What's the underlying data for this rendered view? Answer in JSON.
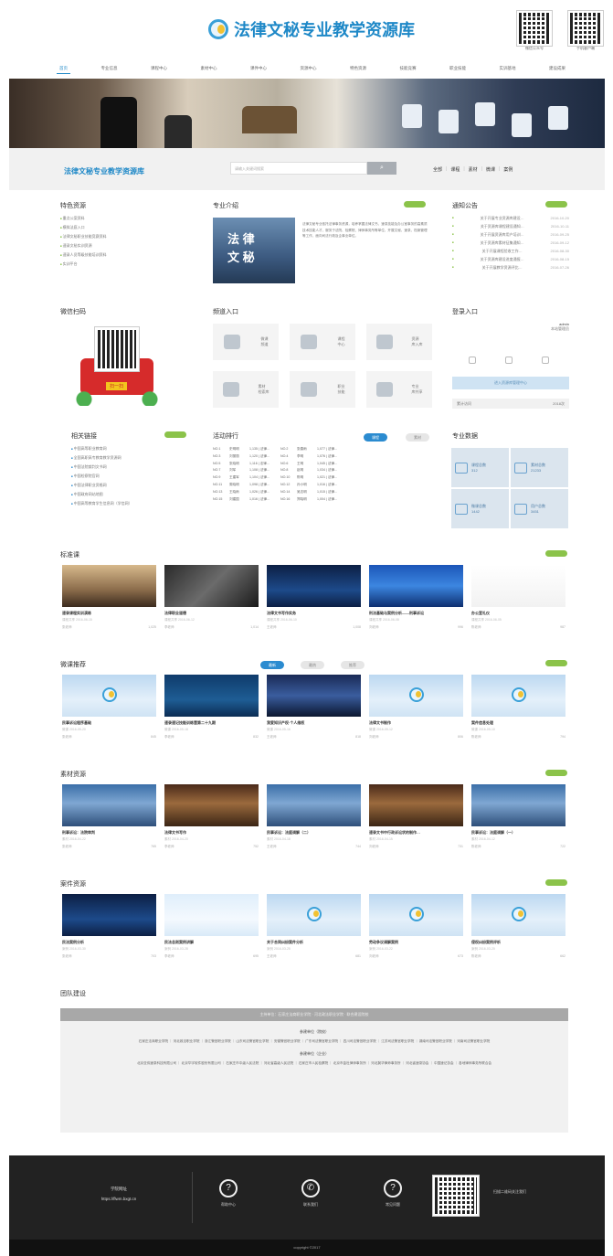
{
  "header": {
    "site_title": "法律文秘专业教学资源库",
    "qr": [
      {
        "caption": "微信公众号"
      },
      {
        "caption": "手机客户端"
      }
    ]
  },
  "nav": {
    "items": [
      "首页",
      "专业信息",
      "课程中心",
      "素材中心",
      "课件中心",
      "资源中心",
      "特色资源",
      "技能竞赛",
      "职业技能",
      "实训基地",
      "建设成果"
    ],
    "active": 0
  },
  "search": {
    "band_title": "法律文秘专业教学资源库",
    "placeholder": "请输入关键词搜索",
    "button": "搜索",
    "links": [
      "全部",
      "课程",
      "素材",
      "微课",
      "案例"
    ]
  },
  "feature": {
    "title": "特色资源",
    "items": [
      "重点公案资料",
      "模拟法庭入口",
      "法律文秘职业技能竞赛资料",
      "速录文秘实训资源",
      "速录人员等级技能培训资料",
      "实训平台"
    ]
  },
  "intro": {
    "title": "专业介绍",
    "image_text": [
      "法 律",
      "文 秘"
    ],
    "text": "法律文秘专业依托法律事务资源，培养掌握法律文书、速录技能及办公室事务的高素质技术技能人才，服务于法院、检察院、律师事务所等单位，开展文秘、速录、档案管理等工作，面向司法行政及企事业单位。"
  },
  "notice": {
    "title": "通知公告",
    "items": [
      {
        "t": "关于开展专业资源库建设…",
        "d": "2016-10-20"
      },
      {
        "t": "关于资源库课程建设通知…",
        "d": "2016-10-11"
      },
      {
        "t": "关于开展资源库用户培训…",
        "d": "2016-09-25"
      },
      {
        "t": "关于资源库素材征集通知…",
        "d": "2016-09-12"
      },
      {
        "t": "关于开展课程验收工作…",
        "d": "2016-08-30"
      },
      {
        "t": "关于资源库建设进度通报…",
        "d": "2016-08-15"
      },
      {
        "t": "关于开展教学资源评比…",
        "d": "2016-07-26"
      }
    ]
  },
  "wechat": {
    "title": "微信扫码",
    "badge": "扫一扫"
  },
  "entry": {
    "title": "频道入口",
    "tiles": [
      [
        "微课",
        "频道"
      ],
      [
        "课程",
        "中心"
      ],
      [
        "资源",
        "库入库"
      ],
      [
        "素材",
        "检索库"
      ],
      [
        "职业",
        "技能"
      ],
      [
        "专业",
        "库共享"
      ]
    ]
  },
  "login": {
    "title": "登录入口",
    "user": "admin",
    "role": "本站管理员",
    "button": "进入资源库管理中心",
    "stat_label": "累计访问",
    "stat_value": "2018次"
  },
  "links": {
    "title": "相关链接",
    "items": [
      "中国高等职业教育网",
      "全国高职高专教育教学资源网",
      "中国法院裁判文书网",
      "中国检察院官网",
      "中国法律职业资格网",
      "中国政府网站地图",
      "中国高等教育学生信息网（学信网）"
    ]
  },
  "rank": {
    "title": "活动排行",
    "tabs": [
      "课程",
      "素材"
    ],
    "rows": [
      [
        "NO.1",
        "史明明",
        "1,135 | 法律..."
      ],
      [
        "NO.2",
        "张春雨",
        "1,077 | 法律..."
      ],
      [
        "NO.3",
        "刘丽丽",
        "1,120 | 法律..."
      ],
      [
        "NO.4",
        "李明",
        "1,076 | 法律..."
      ],
      [
        "NO.5",
        "张晓明",
        "1,116 | 法律..."
      ],
      [
        "NO.6",
        "王明",
        "1,045 | 法律..."
      ],
      [
        "NO.7",
        "刘军",
        "1,108 | 法律..."
      ],
      [
        "NO.8",
        "赵明",
        "1,034 | 法律..."
      ],
      [
        "NO.9",
        "王建军",
        "1,104 | 法律..."
      ],
      [
        "NO.10",
        "陈明",
        "1,021 | 法律..."
      ],
      [
        "NO.11",
        "周晓明",
        "1,098 | 法律..."
      ],
      [
        "NO.12",
        "孙小明",
        "1,016 | 法律..."
      ],
      [
        "NO.13",
        "王晓雨",
        "1,026 | 法律..."
      ],
      [
        "NO.14",
        "吴志明",
        "1,015 | 法律..."
      ],
      [
        "NO.15",
        "刘建国",
        "1,016 | 法律..."
      ],
      [
        "NO.16",
        "郑晓明",
        "1,004 | 法律..."
      ]
    ]
  },
  "data": {
    "title": "专业数据",
    "cells": [
      [
        "课程总数",
        "312"
      ],
      [
        "素材总数",
        "21233"
      ],
      [
        "微课总数",
        "1442"
      ],
      [
        "用户总数",
        "3451"
      ]
    ]
  },
  "sections": [
    {
      "title": "标准课",
      "cards": [
        {
          "t": "速录课程实训演练",
          "s": "课程共享 2016-06-15",
          "a": "张老师",
          "n": "1,025"
        },
        {
          "t": "法律职业道德",
          "s": "课程共享 2016-06-12",
          "a": "李老师",
          "n": "1,014"
        },
        {
          "t": "法律文书写作实务",
          "s": "课程共享 2016-06-10",
          "a": "王老师",
          "n": "1,008"
        },
        {
          "t": "刑法基础与案例分析——刑事诉讼",
          "s": "课程共享 2016-06-08",
          "a": "刘老师",
          "n": "996"
        },
        {
          "t": "办公室礼仪",
          "s": "课程共享 2016-06-05",
          "a": "陈老师",
          "n": "987"
        }
      ]
    },
    {
      "title": "微课推荐",
      "tabs": [
        "最新",
        "最热",
        "推荐"
      ],
      "cards": [
        {
          "t": "民事诉讼程序基础",
          "s": "微课 2016-05-20",
          "a": "张老师",
          "n": "845"
        },
        {
          "t": "速录速记技能训练营第二十九期",
          "s": "微课 2016-05-18",
          "a": "李老师",
          "n": "832"
        },
        {
          "t": "我爱知识产权·个人维权",
          "s": "微课 2016-05-16",
          "a": "王老师",
          "n": "818"
        },
        {
          "t": "法律文书制作",
          "s": "微课 2016-05-12",
          "a": "刘老师",
          "n": "806"
        },
        {
          "t": "案件信息处理",
          "s": "微课 2016-05-10",
          "a": "陈老师",
          "n": "794"
        }
      ]
    },
    {
      "title": "素材资源",
      "cards": [
        {
          "t": "刑事诉讼：法院审判",
          "s": "素材 2016-04-22",
          "a": "张老师",
          "n": "765"
        },
        {
          "t": "法律文书写作",
          "s": "素材 2016-04-20",
          "a": "李老师",
          "n": "752"
        },
        {
          "t": "民事诉讼：法庭调解（二）",
          "s": "素材 2016-04-18",
          "a": "王老师",
          "n": "744"
        },
        {
          "t": "速录文书中行政诉讼状的制作…",
          "s": "素材 2016-04-15",
          "a": "刘老师",
          "n": "731"
        },
        {
          "t": "民事诉讼：法庭调解（一）",
          "s": "素材 2016-04-12",
          "a": "陈老师",
          "n": "722"
        }
      ]
    },
    {
      "title": "案件资源",
      "cards": [
        {
          "t": "民法案例分析",
          "s": "案例 2016-03-30",
          "a": "张老师",
          "n": "703"
        },
        {
          "t": "民法总则案例讲解",
          "s": "案例 2016-03-28",
          "a": "李老师",
          "n": "695"
        },
        {
          "t": "关于合同纠纷案件分析",
          "s": "案例 2016-03-25",
          "a": "王老师",
          "n": "681"
        },
        {
          "t": "劳动争议调解案例",
          "s": "案例 2016-03-22",
          "a": "刘老师",
          "n": "673"
        },
        {
          "t": "侵权纠纷案例评析",
          "s": "案例 2016-03-20",
          "a": "陈老师",
          "n": "662"
        }
      ]
    }
  ],
  "team": {
    "title": "团队建设",
    "bar": "主持单位：石家庄法商职业学院 · 河北政法职业学院 · 联合建设院校",
    "head1": "参建单位（院校）",
    "body1": "石家庄法商职业学院 ｜ 河北政法职业学院 ｜ 浙江警官职业学院 ｜ 山东司法警官职业学院 ｜ 安徽警官职业学院 ｜ 广东司法警官职业学院 ｜ 四川司法警官职业学院 ｜ 江苏司法警官职业学院 ｜ 湖南司法警官职业学院 ｜ 河南司法警官职业学院",
    "head2": "参建单位（企业）",
    "body2": "北京亚伟速录科技有限公司 ｜ 北京华宇软件股份有限公司 ｜ 石家庄市中级人民法院 ｜ 河北省高级人民法院 ｜ 石家庄市人民检察院 ｜ 北京市金杜律师事务所 ｜ 河北冀华律师事务所 ｜ 河北省速录协会 ｜ 中国速记协会 ｜ 各地律师事务所联合会"
  },
  "footer": {
    "addr_label": "学院网址",
    "addr": "https://flwm.bxgt.cn",
    "icons": [
      {
        "g": "?",
        "label": "帮助中心"
      },
      {
        "g": "✆",
        "label": "联系我们"
      },
      {
        "g": "?",
        "label": "常见问题"
      }
    ],
    "qr_text": "扫描二维码关注我们",
    "copyright": "copyright ©2017"
  },
  "colors": {
    "accent": "#1e88c7",
    "more": "#8bc34a",
    "footer": "#222222"
  }
}
